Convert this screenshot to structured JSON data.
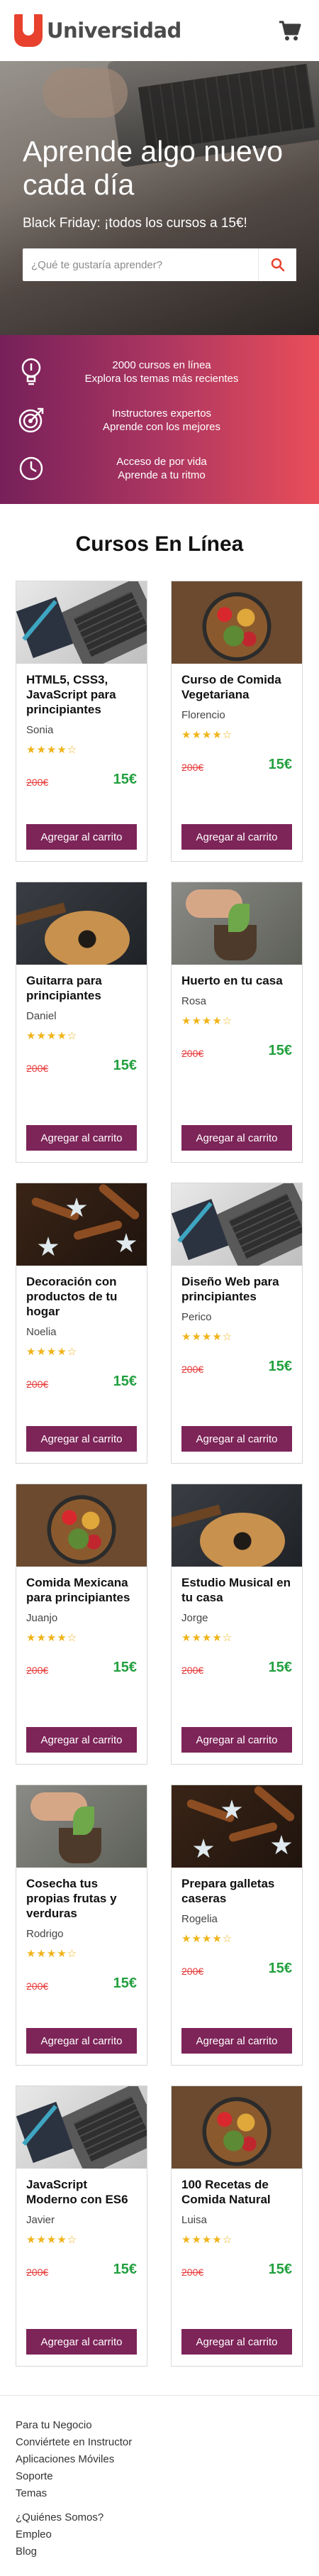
{
  "header": {
    "brand": "Universidad",
    "logo_color": "#e8412e",
    "cart_icon": "shopping-cart-icon"
  },
  "hero": {
    "title": "Aprende algo nuevo cada día",
    "subtitle": "Black Friday: ¡todos los cursos a 15€!",
    "search_placeholder": "¿Qué te gustaría aprender?",
    "search_icon": "search-icon",
    "accent_color": "#e8412e"
  },
  "features": [
    {
      "icon": "lightbulb-icon",
      "line1": "2000 cursos en línea",
      "line2": "Explora los temas más recientes"
    },
    {
      "icon": "target-icon",
      "line1": "Instructores expertos",
      "line2": "Aprende con los mejores"
    },
    {
      "icon": "clock-icon",
      "line1": "Acceso de por vida",
      "line2": "Aprende a tu ritmo"
    }
  ],
  "courses_section": {
    "title": "Cursos En Línea",
    "add_to_cart_label": "Agregar al carrito",
    "button_color": "#7d2458",
    "old_price_color": "#e63b3b",
    "new_price_color": "#23a03f",
    "star_color": "#f0b419"
  },
  "courses": [
    {
      "title": "HTML5, CSS3, JavaScript para principiantes",
      "author": "Sonia",
      "rating_stars": 4.5,
      "stars_display": "★★★★☆",
      "old_price": "200€",
      "new_price": "15€",
      "image": "laptop"
    },
    {
      "title": "Curso de Comida Vegetariana",
      "author": "Florencio",
      "rating_stars": 4.5,
      "stars_display": "★★★★☆",
      "old_price": "200€",
      "new_price": "15€",
      "image": "bowl"
    },
    {
      "title": "Guitarra para principiantes",
      "author": "Daniel",
      "rating_stars": 4.5,
      "stars_display": "★★★★☆",
      "old_price": "200€",
      "new_price": "15€",
      "image": "guitar"
    },
    {
      "title": "Huerto en tu casa",
      "author": "Rosa",
      "rating_stars": 4.5,
      "stars_display": "★★★★☆",
      "old_price": "200€",
      "new_price": "15€",
      "image": "plant"
    },
    {
      "title": "Decoración con productos de tu hogar",
      "author": "Noelia",
      "rating_stars": 4.5,
      "stars_display": "★★★★☆",
      "old_price": "200€",
      "new_price": "15€",
      "image": "cinnamon"
    },
    {
      "title": "Diseño Web para principiantes",
      "author": "Perico",
      "rating_stars": 4.5,
      "stars_display": "★★★★☆",
      "old_price": "200€",
      "new_price": "15€",
      "image": "laptop"
    },
    {
      "title": "Comida Mexicana para principiantes",
      "author": "Juanjo",
      "rating_stars": 4.5,
      "stars_display": "★★★★☆",
      "old_price": "200€",
      "new_price": "15€",
      "image": "bowl"
    },
    {
      "title": "Estudio Musical en tu casa",
      "author": "Jorge",
      "rating_stars": 4.5,
      "stars_display": "★★★★☆",
      "old_price": "200€",
      "new_price": "15€",
      "image": "guitar"
    },
    {
      "title": "Cosecha tus propias frutas y verduras",
      "author": "Rodrigo",
      "rating_stars": 4.5,
      "stars_display": "★★★★☆",
      "old_price": "200€",
      "new_price": "15€",
      "image": "plant"
    },
    {
      "title": "Prepara galletas caseras",
      "author": "Rogelia",
      "rating_stars": 4.5,
      "stars_display": "★★★★☆",
      "old_price": "200€",
      "new_price": "15€",
      "image": "cinnamon"
    },
    {
      "title": "JavaScript Moderno con ES6",
      "author": "Javier",
      "rating_stars": 4.5,
      "stars_display": "★★★★☆",
      "old_price": "200€",
      "new_price": "15€",
      "image": "laptop"
    },
    {
      "title": "100 Recetas de Comida Natural",
      "author": "Luisa",
      "rating_stars": 4.5,
      "stars_display": "★★★★☆",
      "old_price": "200€",
      "new_price": "15€",
      "image": "bowl"
    }
  ],
  "footer": {
    "group1": [
      "Para tu Negocio",
      "Conviértete en Instructor",
      "Aplicaciones Móviles",
      "Soporte",
      "Temas"
    ],
    "group2": [
      "¿Quiénes Somos?",
      "Empleo",
      "Blog"
    ]
  }
}
